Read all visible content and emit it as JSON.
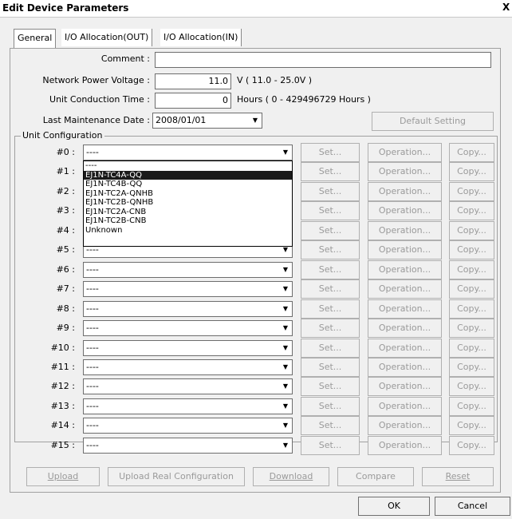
{
  "window": {
    "title": "Edit Device Parameters",
    "close_glyph": "X"
  },
  "tabs": [
    {
      "label": "General"
    },
    {
      "label": "I/O Allocation(OUT)"
    },
    {
      "label": "I/O Allocation(IN)"
    }
  ],
  "general": {
    "comment_label": "Comment :",
    "comment_value": "",
    "npv_label": "Network Power Voltage :",
    "npv_value": "11.0",
    "npv_unit": "V ( 11.0 - 25.0V )",
    "uct_label": "Unit Conduction Time :",
    "uct_value": "0",
    "uct_unit": "Hours ( 0 - 429496729 Hours )",
    "lmd_label": "Last Maintenance Date :",
    "lmd_value": "2008/01/01",
    "default_setting": "Default Setting"
  },
  "unit_config": {
    "title": "Unit Configuration",
    "set_label": "Set...",
    "operation_label": "Operation...",
    "copy_label": "Copy...",
    "units": [
      {
        "label": "#0 :",
        "value": "----"
      },
      {
        "label": "#1 :",
        "value": "----"
      },
      {
        "label": "#2 :",
        "value": "----"
      },
      {
        "label": "#3 :",
        "value": "----"
      },
      {
        "label": "#4 :",
        "value": "----"
      },
      {
        "label": "#5 :",
        "value": "----"
      },
      {
        "label": "#6 :",
        "value": "----"
      },
      {
        "label": "#7 :",
        "value": "----"
      },
      {
        "label": "#8 :",
        "value": "----"
      },
      {
        "label": "#9 :",
        "value": "----"
      },
      {
        "label": "#10 :",
        "value": "----"
      },
      {
        "label": "#11 :",
        "value": "----"
      },
      {
        "label": "#12 :",
        "value": "----"
      },
      {
        "label": "#13 :",
        "value": "----"
      },
      {
        "label": "#14 :",
        "value": "----"
      },
      {
        "label": "#15 :",
        "value": "----"
      }
    ],
    "dropdown_options": [
      "----",
      "EJ1N-TC4A-QQ",
      "EJ1N-TC4B-QQ",
      "EJ1N-TC2A-QNHB",
      "EJ1N-TC2B-QNHB",
      "EJ1N-TC2A-CNB",
      "EJ1N-TC2B-CNB",
      "Unknown"
    ],
    "dropdown_selected": "EJ1N-TC4A-QQ"
  },
  "bottom_buttons": {
    "upload": "Upload",
    "upload_real": "Upload Real Configuration",
    "download": "Download",
    "compare": "Compare",
    "reset": "Reset"
  },
  "dialog_buttons": {
    "ok": "OK",
    "cancel": "Cancel"
  }
}
